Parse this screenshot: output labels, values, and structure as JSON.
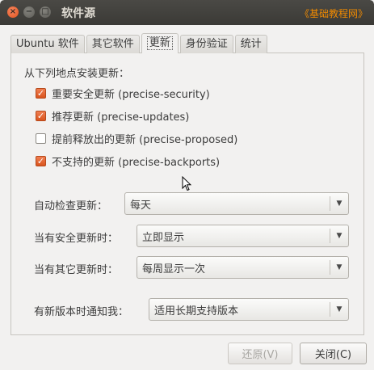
{
  "window": {
    "title": "软件源",
    "watermark": "《基础教程网》"
  },
  "titlebar_buttons": {
    "close": "×",
    "minimize": "−",
    "maximize": "□"
  },
  "tabs": [
    {
      "label": "Ubuntu 软件"
    },
    {
      "label": "其它软件"
    },
    {
      "label": "更新"
    },
    {
      "label": "身份验证"
    },
    {
      "label": "统计"
    }
  ],
  "active_tab": "更新",
  "updates": {
    "heading": "从下列地点安装更新：",
    "sources": [
      {
        "label": "重要安全更新 (precise-security)",
        "checked": true
      },
      {
        "label": "推荐更新 (precise-updates)",
        "checked": true
      },
      {
        "label": "提前释放出的更新 (precise-proposed)",
        "checked": false
      },
      {
        "label": "不支持的更新 (precise-backports)",
        "checked": true
      }
    ],
    "auto_check": {
      "label": "自动检查更新：",
      "value": "每天"
    },
    "security_updates": {
      "label": "当有安全更新时：",
      "value": "立即显示"
    },
    "other_updates": {
      "label": "当有其它更新时：",
      "value": "每周显示一次"
    },
    "notify_version": {
      "label": "有新版本时通知我：",
      "value": "适用长期支持版本"
    }
  },
  "buttons": {
    "revert": "还原(V)",
    "close": "关闭(C)"
  },
  "colors": {
    "accent": "#dd5424",
    "titlebar": "#3c3b37",
    "window_bg": "#f2f1f0"
  }
}
